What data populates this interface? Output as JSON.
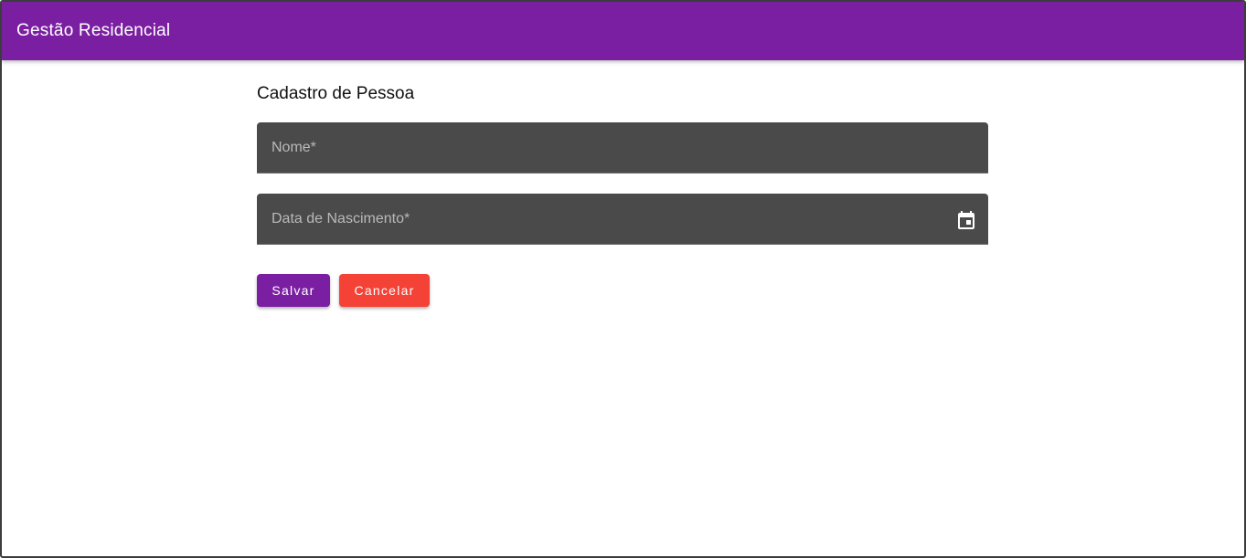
{
  "app": {
    "title": "Gestão Residencial"
  },
  "form": {
    "title": "Cadastro de Pessoa",
    "nome": {
      "placeholder": "Nome*",
      "value": ""
    },
    "data_nascimento": {
      "placeholder": "Data de Nascimento*",
      "value": "",
      "icon": "calendar-icon"
    }
  },
  "actions": {
    "save_label": "Salvar",
    "cancel_label": "Cancelar"
  },
  "colors": {
    "primary": "#7b1fa2",
    "warn": "#f44336",
    "field_bg": "#4a4a4a"
  }
}
